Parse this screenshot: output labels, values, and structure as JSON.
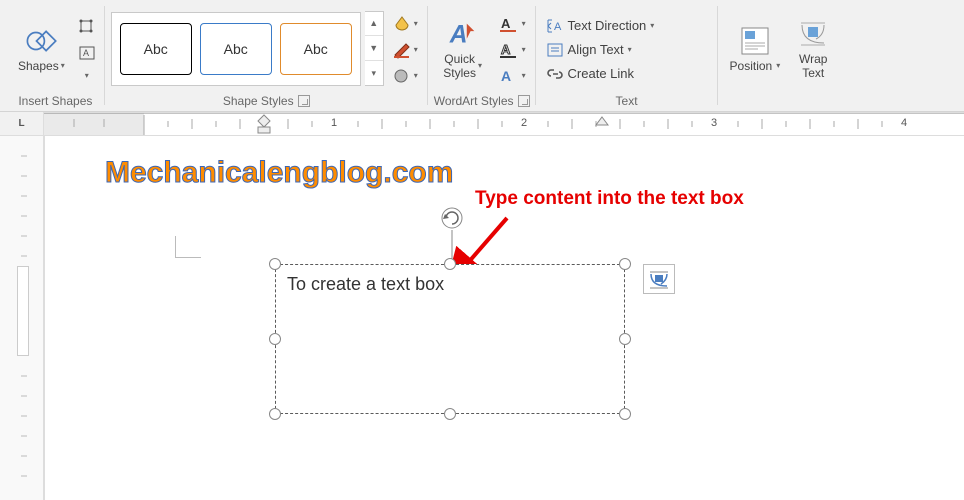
{
  "ribbon": {
    "insert_shapes": {
      "shapes_label": "Shapes",
      "caption": "Insert Shapes"
    },
    "shape_styles": {
      "abc": "Abc",
      "caption": "Shape Styles"
    },
    "wordart": {
      "quick_styles_label": "Quick\nStyles",
      "caption": "WordArt Styles"
    },
    "text": {
      "direction_label": "Text Direction",
      "align_label": "Align Text",
      "link_label": "Create Link",
      "caption": "Text"
    },
    "arrange": {
      "position_label": "Position",
      "wrap_label": "Wrap\nText"
    }
  },
  "ruler": {
    "corner": "L",
    "n1": "1",
    "n2": "2",
    "n3": "3",
    "n4": "4"
  },
  "page": {
    "watermark": "Mechanicalengblog.com",
    "textbox_content": "To create a text box",
    "annotation": "Type content into the text box"
  }
}
